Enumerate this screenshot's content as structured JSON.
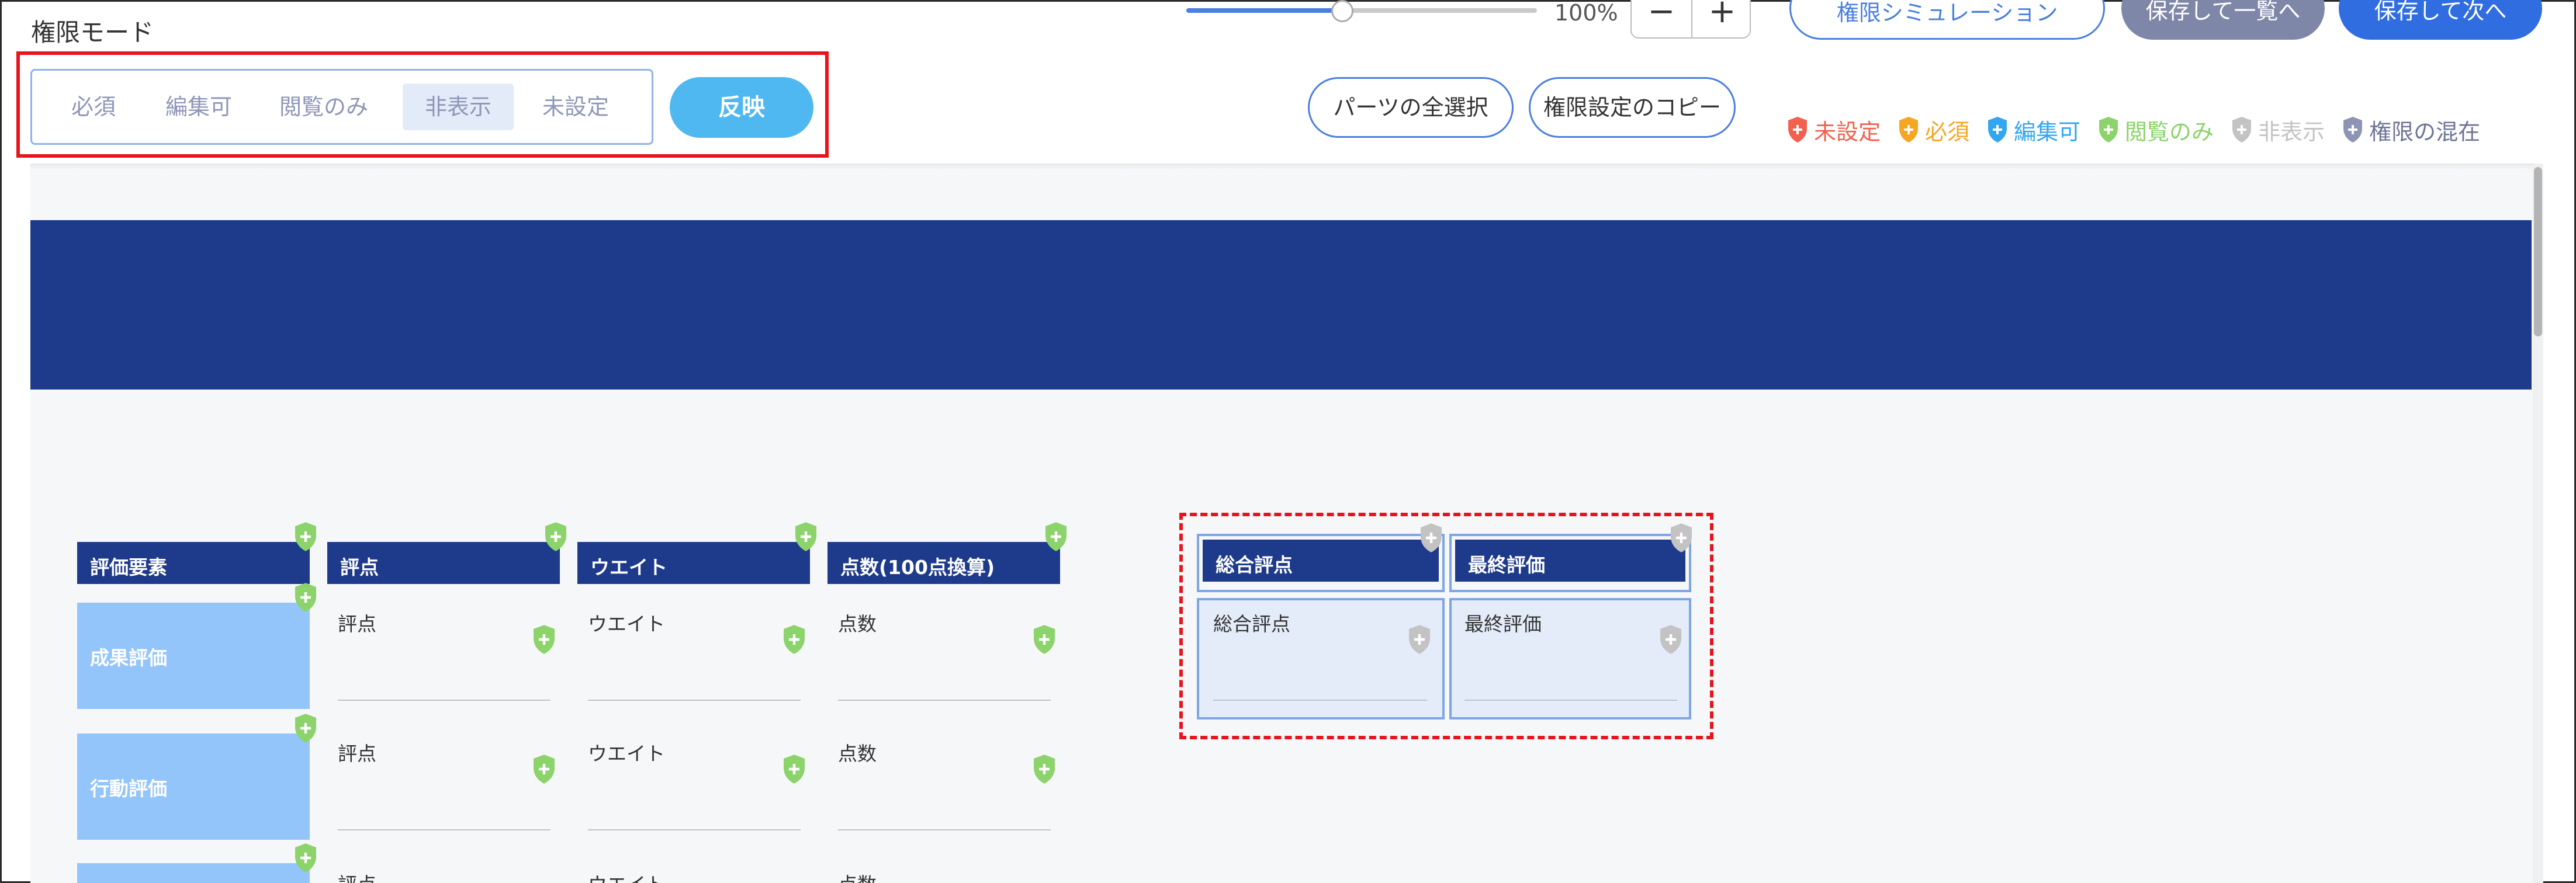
{
  "header": {
    "title": "権限モード",
    "zoom_level": "100%",
    "zoom_out_label": "−",
    "zoom_in_label": "+",
    "simulation_label": "権限シミュレーション",
    "save_list_label": "保存して一覧へ",
    "save_next_label": "保存して次へ"
  },
  "permission_mode": {
    "options": [
      "必須",
      "編集可",
      "閲覧のみ",
      "非表示",
      "未設定"
    ],
    "selected": "非表示",
    "apply_label": "反映"
  },
  "actions": {
    "select_all_label": "パーツの全選択",
    "copy_label": "権限設定のコピー"
  },
  "legend": [
    {
      "label": "未設定",
      "color": "#f2604f"
    },
    {
      "label": "必須",
      "color": "#f5a623"
    },
    {
      "label": "編集可",
      "color": "#33a6f0"
    },
    {
      "label": "閲覧のみ",
      "color": "#8bd36a"
    },
    {
      "label": "非表示",
      "color": "#c3c3c3"
    },
    {
      "label": "権限の混在",
      "color": "#8d94b4"
    }
  ],
  "form": {
    "headers": [
      "評価要素",
      "評点",
      "ウエイト",
      "点数(100点換算)"
    ],
    "rows": [
      {
        "label": "成果評価",
        "fields": [
          "評点",
          "ウエイト",
          "点数"
        ]
      },
      {
        "label": "行動評価",
        "fields": [
          "評点",
          "ウエイト",
          "点数"
        ]
      },
      {
        "label": "",
        "fields": [
          "評点",
          "ウエイト",
          "点数"
        ]
      }
    ],
    "summary_headers": [
      "総合評点",
      "最終評価"
    ],
    "summary_fields": [
      "総合評点",
      "最終評価"
    ]
  },
  "colors": {
    "navy": "#1e3a8a",
    "accent": "#4a7fe0",
    "apply": "#4fb8f0",
    "readonly_shield": "#8bd36a",
    "hidden_shield": "#c3c3c3"
  }
}
